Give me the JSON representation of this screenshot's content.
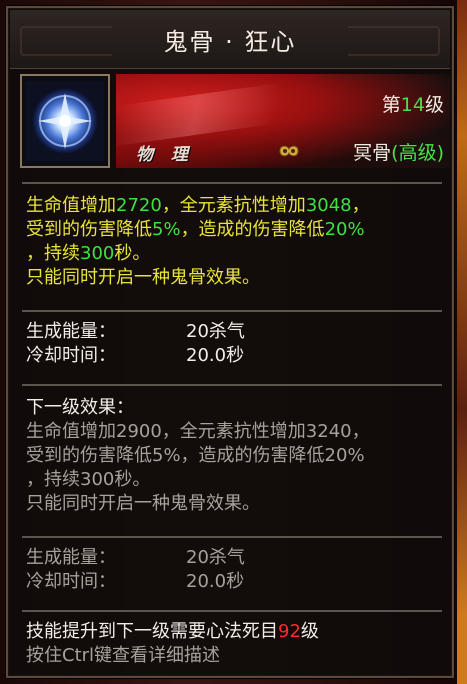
{
  "title": "鬼骨 · 狂心",
  "skill_type": "物 理",
  "level": {
    "prefix": "第",
    "value": "14",
    "suffix": "级"
  },
  "school": {
    "name": "冥骨",
    "grade_open": "(",
    "grade": "高级",
    "grade_close": ")"
  },
  "current_effect": {
    "line1": [
      "生命值增加",
      "2720",
      "，全元素抗性增加",
      "3048",
      "，"
    ],
    "line2": [
      "受到的伤害降低",
      "5%",
      "，造成的伤害降低",
      "20%"
    ],
    "line3": [
      "，持续",
      "300",
      "秒。"
    ],
    "line4": "只能同时开启一种鬼骨效果。"
  },
  "current_stats": [
    {
      "label": "生成能量：",
      "value": "20杀气"
    },
    {
      "label": "冷却时间：",
      "value": "20.0秒"
    }
  ],
  "next_level": {
    "header": "下一级效果：",
    "line1": "生命值增加2900，全元素抗性增加3240，",
    "line2": "受到的伤害降低5%，造成的伤害降低20%",
    "line3": "，持续300秒。",
    "line4": "只能同时开启一种鬼骨效果。"
  },
  "next_stats": [
    {
      "label": "生成能量：",
      "value": "20杀气"
    },
    {
      "label": "冷却时间：",
      "value": "20.0秒"
    }
  ],
  "requirement": {
    "text": "技能提升到下一级需要心法死目",
    "value": "92",
    "suffix": "级"
  },
  "hint": "按住Ctrl键查看详细描述",
  "colors": {
    "highlight_green": "#3fe13f",
    "effect_yellow": "#e8e43a",
    "required_red": "#ff2a2a"
  },
  "icons": {
    "skill": "blue-orb-skill-icon",
    "school": "bone-sigil-icon"
  }
}
